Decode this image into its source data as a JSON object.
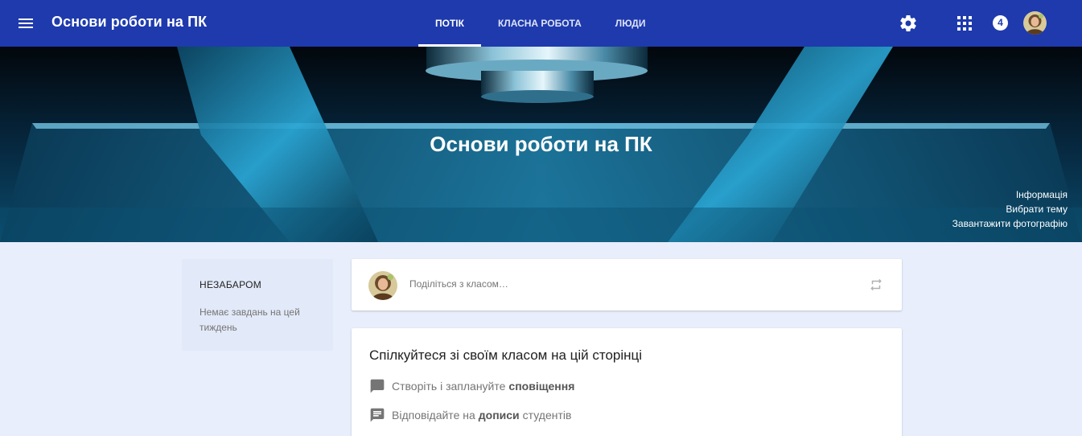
{
  "app": {
    "title": "Основи роботи на ПК"
  },
  "tabs": [
    {
      "label": "ПОТІК",
      "active": true
    },
    {
      "label": "КЛАСНА РОБОТА",
      "active": false
    },
    {
      "label": "ЛЮДИ",
      "active": false
    }
  ],
  "header": {
    "notification_count": "4",
    "icons": [
      "menu-icon",
      "gear-icon",
      "apps-grid-icon",
      "avatar"
    ]
  },
  "banner": {
    "title": "Основи роботи на ПК",
    "links": {
      "info": "Інформація",
      "choose_theme": "Вибрати тему",
      "upload_photo": "Завантажити фотографію"
    }
  },
  "upcoming": {
    "title": "НЕЗАБАРОМ",
    "empty_text": "Немає завдань на цей тиждень"
  },
  "share": {
    "placeholder": "Поділіться з класом…"
  },
  "info_card": {
    "title": "Спілкуйтеся зі своїм класом на цій сторінці",
    "row1": {
      "prefix": "Створіть і заплануйте",
      "bold": "сповіщення",
      "suffix": ""
    },
    "row2": {
      "prefix": "Відповідайте на",
      "bold": "дописи",
      "suffix": "студентів"
    }
  },
  "colors": {
    "header_bg": "#1e3aad",
    "page_bg": "#e8eefb",
    "sidebar_bg": "#e2e9f8",
    "banner_accent": "#1a9fd0"
  }
}
